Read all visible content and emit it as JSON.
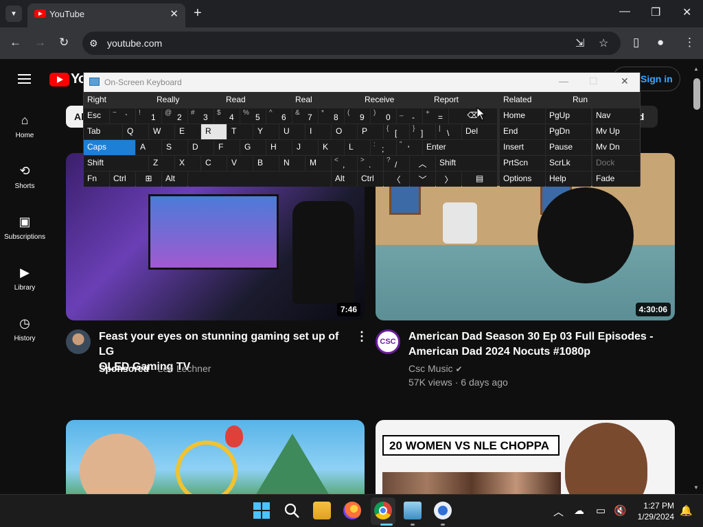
{
  "browser": {
    "tab_title": "YouTube",
    "url": "youtube.com",
    "new_tab": "+",
    "tab_close": "✕",
    "minimize": "—",
    "maximize": "❐",
    "close": "✕"
  },
  "youtube": {
    "logo_text": "Yo",
    "sign_in": "Sign in",
    "chip_all": "Al",
    "chip_right": "ed",
    "guide": [
      {
        "label": "Home",
        "icon": "home-icon"
      },
      {
        "label": "Shorts",
        "icon": "shorts-icon"
      },
      {
        "label": "Subscriptions",
        "icon": "subscriptions-icon"
      },
      {
        "label": "Library",
        "icon": "library-icon"
      },
      {
        "label": "History",
        "icon": "history-icon"
      }
    ],
    "videos": [
      {
        "title_line1": "Feast your eyes on stunning gaming set up of LG",
        "title_line2": "OLED Gaming TV",
        "sponsored": "Sponsored",
        "channel": "Lee Lechner",
        "duration": "7:46"
      },
      {
        "title_line1": "American Dad Season 30 Ep 03 Full Episodes -",
        "title_line2": "American Dad 2024 Nocuts #1080p",
        "channel": "Csc Music",
        "views": "57K views",
        "age": "6 days ago",
        "duration": "4:30:06",
        "avatar_text": "CSC"
      },
      {
        "title": "",
        "duration": ""
      },
      {
        "thumbnail_text": "20 WOMEN VS NLE CHOPPA"
      }
    ]
  },
  "osk": {
    "title": "On-Screen Keyboard",
    "predictions": [
      "Right",
      "Really",
      "Read",
      "Real",
      "Receive",
      "Report",
      "Related",
      "Run"
    ],
    "row1": {
      "esc": "Esc",
      "tilde_top": "~",
      "tilde_bot": "`",
      "k1t": "!",
      "k1": "1",
      "k2t": "@",
      "k2": "2",
      "k3t": "#",
      "k3": "3",
      "k4t": "$",
      "k4": "4",
      "k5t": "%",
      "k5": "5",
      "k6t": "^",
      "k6": "6",
      "k7t": "&",
      "k7": "7",
      "k8t": "*",
      "k8": "8",
      "k9t": "(",
      "k9": "9",
      "k0t": ")",
      "k0": "0",
      "minus_t": "_",
      "minus": "-",
      "plus_t": "+",
      "plus": "="
    },
    "row2": [
      "Tab",
      "Q",
      "W",
      "E",
      "R",
      "T",
      "Y",
      "U",
      "I",
      "O",
      "P",
      "Del"
    ],
    "row2_sym": {
      "lb_t": "{",
      "lb": "[",
      "rb_t": "}",
      "rb": "]",
      "bs_t": "|",
      "bs": "\\"
    },
    "row3": [
      "Caps",
      "A",
      "S",
      "D",
      "F",
      "G",
      "H",
      "J",
      "K",
      "L",
      "Enter"
    ],
    "row3_sym": {
      "sc_t": ":",
      "sc": ";",
      "q_t": "\"",
      "q": "'"
    },
    "row4": [
      "Shift",
      "Z",
      "X",
      "C",
      "V",
      "B",
      "N",
      "M",
      "Shift"
    ],
    "row4_sym": {
      "lt_t": "<",
      "lt": ",",
      "gt_t": ">",
      "gt": ".",
      "qm_t": "?",
      "qm": "/"
    },
    "row5": {
      "fn": "Fn",
      "ctrl": "Ctrl",
      "alt": "Alt",
      "alt2": "Alt",
      "ctrl2": "Ctrl"
    },
    "nav_keys": [
      [
        "Home",
        "PgUp",
        "Nav"
      ],
      [
        "End",
        "PgDn",
        "Mv Up"
      ],
      [
        "Insert",
        "Pause",
        "Mv Dn"
      ],
      [
        "PrtScn",
        "ScrLk",
        "Dock"
      ],
      [
        "Options",
        "Help",
        "Fade"
      ]
    ]
  },
  "taskbar": {
    "time": "1:27 PM",
    "date": "1/29/2024"
  }
}
